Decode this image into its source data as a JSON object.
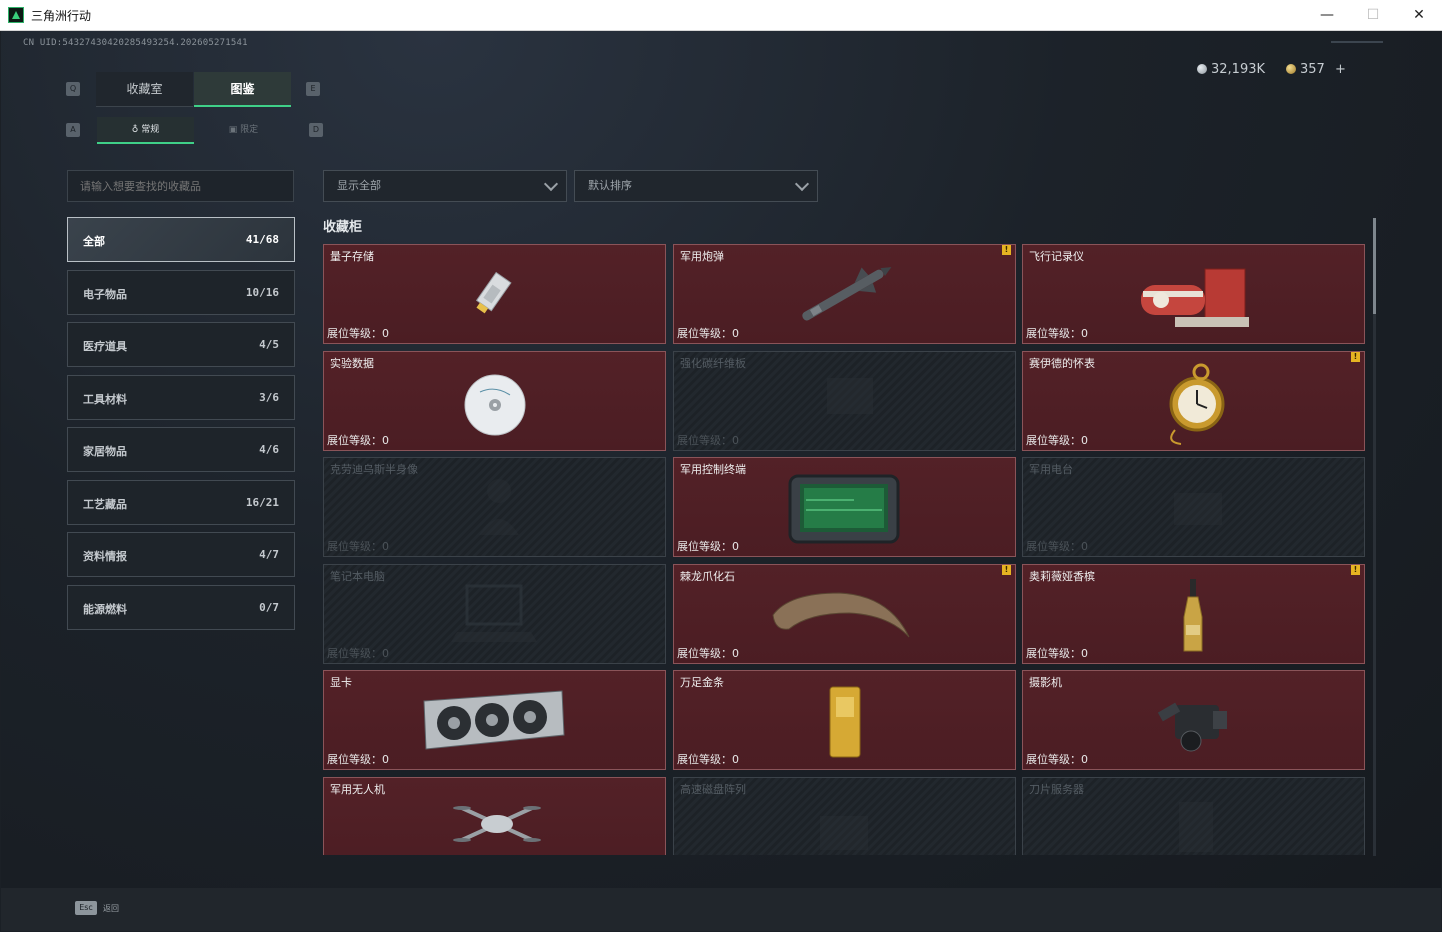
{
  "window": {
    "title": "三角洲行动",
    "min": "—",
    "max": "☐",
    "close": "✕"
  },
  "uid": "CN UID:5432743042028549325​4.202605271541",
  "currency": {
    "silver": "32,193K",
    "gold": "357",
    "add": "+"
  },
  "keys": {
    "q": "Q",
    "e": "E",
    "a": "A",
    "d": "D",
    "esc": "Esc"
  },
  "tabs": {
    "collection": "收藏室",
    "atlas": "图鉴",
    "regular": "常规",
    "limited": "限定"
  },
  "search": {
    "placeholder": "请输入想要查找的收藏品"
  },
  "categories": [
    {
      "name": "全部",
      "count": "41/68"
    },
    {
      "name": "电子物品",
      "count": "10/16"
    },
    {
      "name": "医疗道具",
      "count": "4/5"
    },
    {
      "name": "工具材料",
      "count": "3/6"
    },
    {
      "name": "家居物品",
      "count": "4/6"
    },
    {
      "name": "工艺藏品",
      "count": "16/21"
    },
    {
      "name": "资料情报",
      "count": "4/7"
    },
    {
      "name": "能源燃料",
      "count": "0/7"
    }
  ],
  "filters": {
    "show": "显示全部",
    "sort": "默认排序"
  },
  "section_title": "收藏柜",
  "level_label": "展位等级：0",
  "items": [
    {
      "name": "量子存储",
      "owned": true,
      "badge": "",
      "icon": "ssd-icon"
    },
    {
      "name": "军用炮弹",
      "owned": true,
      "badge": "!",
      "icon": "missile-icon"
    },
    {
      "name": "飞行记录仪",
      "owned": true,
      "badge": "",
      "icon": "flight-recorder-icon"
    },
    {
      "name": "实验数据",
      "owned": true,
      "badge": "",
      "icon": "disc-icon"
    },
    {
      "name": "强化碳纤维板",
      "owned": false,
      "badge": "",
      "icon": "carbon-plate-icon"
    },
    {
      "name": "赛伊德的怀表",
      "owned": true,
      "badge": "!",
      "icon": "pocket-watch-icon"
    },
    {
      "name": "克劳迪乌斯半身像",
      "owned": false,
      "badge": "",
      "icon": "bust-icon"
    },
    {
      "name": "军用控制终端",
      "owned": true,
      "badge": "",
      "icon": "terminal-icon"
    },
    {
      "name": "军用电台",
      "owned": false,
      "badge": "",
      "icon": "radio-icon"
    },
    {
      "name": "笔记本电脑",
      "owned": false,
      "badge": "",
      "icon": "laptop-icon"
    },
    {
      "name": "棘龙爪化石",
      "owned": true,
      "badge": "!",
      "icon": "claw-fossil-icon"
    },
    {
      "name": "奥莉薇娅香槟",
      "owned": true,
      "badge": "!",
      "icon": "champagne-icon"
    },
    {
      "name": "显卡",
      "owned": true,
      "badge": "",
      "icon": "gpu-icon"
    },
    {
      "name": "万足金条",
      "owned": true,
      "badge": "",
      "icon": "gold-bar-icon"
    },
    {
      "name": "摄影机",
      "owned": true,
      "badge": "",
      "icon": "camera-icon"
    },
    {
      "name": "军用无人机",
      "owned": true,
      "badge": "",
      "icon": "drone-icon"
    },
    {
      "name": "高速磁盘阵列",
      "owned": false,
      "badge": "",
      "icon": "disk-array-icon"
    },
    {
      "name": "刀片服务器",
      "owned": false,
      "badge": "",
      "icon": "blade-server-icon"
    }
  ],
  "footer": {
    "back": "返回"
  }
}
